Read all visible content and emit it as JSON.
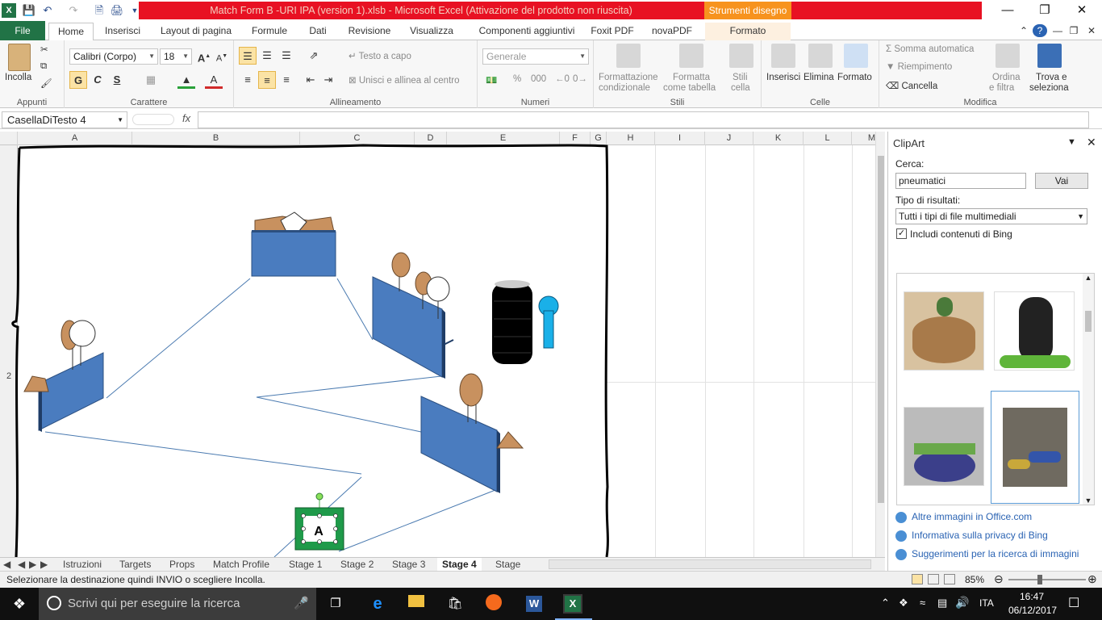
{
  "window": {
    "title": "Match Form B -URI IPA (version 1).xlsb  -  Microsoft Excel (Attivazione del prodotto non riuscita)",
    "contextual_tab_group": "Strumenti disegno"
  },
  "ribbon_tabs": [
    "File",
    "Home",
    "Inserisci",
    "Layout di pagina",
    "Formule",
    "Dati",
    "Revisione",
    "Visualizza",
    "Componenti aggiuntivi",
    "Foxit PDF",
    "novaPDF",
    "Formato"
  ],
  "ribbon": {
    "appunti": {
      "group": "Appunti",
      "paste": "Incolla"
    },
    "carattere": {
      "group": "Carattere",
      "font": "Calibri (Corpo)",
      "size": "18",
      "bold": "G",
      "italic": "C",
      "underline": "S"
    },
    "allineamento": {
      "group": "Allineamento",
      "wrap": "Testo a capo",
      "merge": "Unisci e allinea al centro"
    },
    "numeri": {
      "group": "Numeri",
      "format": "Generale",
      "percent": "%",
      "thousands": "000"
    },
    "stili": {
      "group": "Stili",
      "conditional": [
        "Formattazione",
        "condizionale"
      ],
      "as_table": [
        "Formatta",
        "come tabella"
      ],
      "cell_styles": [
        "Stili",
        "cella"
      ]
    },
    "celle": {
      "group": "Celle",
      "insert": "Inserisci",
      "delete": "Elimina",
      "format": "Formato"
    },
    "modifica": {
      "group": "Modifica",
      "autosum": "Somma automatica",
      "fill": "Riempimento",
      "clear": "Cancella",
      "sort": [
        "Ordina",
        "e filtra"
      ],
      "find": [
        "Trova e",
        "seleziona"
      ]
    }
  },
  "formula_bar": {
    "name_box": "CasellaDiTesto 4",
    "fx": "fx",
    "value": ""
  },
  "columns": [
    "A",
    "B",
    "C",
    "D",
    "E",
    "F",
    "G",
    "H",
    "I",
    "J",
    "K",
    "L",
    "M"
  ],
  "rows": [
    "2"
  ],
  "drawing": {
    "text_box_label": "A"
  },
  "sheet_tabs": [
    "Istruzioni",
    "Targets",
    "Props",
    "Match Profile",
    "Stage 1",
    "Stage 2",
    "Stage 3",
    "Stage 4",
    "Stage"
  ],
  "active_sheet": "Stage 4",
  "status": {
    "message": "Selezionare la destinazione quindi INVIO o scegliere Incolla.",
    "zoom": "85%"
  },
  "clipart": {
    "title": "ClipArt",
    "search_label": "Cerca:",
    "search_value": "pneumatici",
    "go_button": "Vai",
    "result_type_label": "Tipo di risultati:",
    "result_type_value": "Tutti i tipi di file multimediali",
    "include_bing": "Includi contenuti di Bing",
    "links": [
      "Altre immagini in Office.com",
      "Informativa sulla privacy di Bing",
      "Suggerimenti per la ricerca di immagini"
    ]
  },
  "taskbar": {
    "search_placeholder": "Scrivi qui per eseguire la ricerca",
    "language": "ITA",
    "time": "16:47",
    "date": "06/12/2017"
  }
}
